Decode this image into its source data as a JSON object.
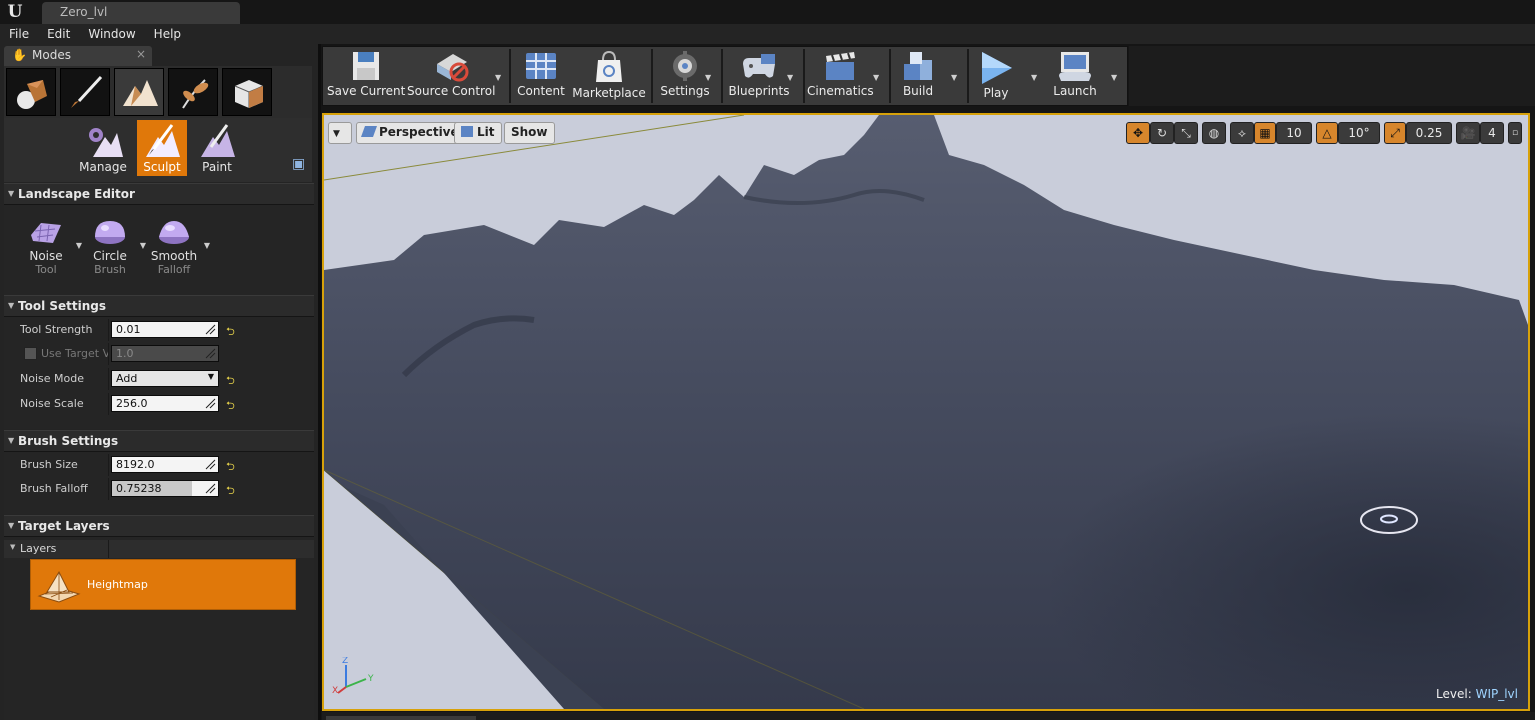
{
  "window": {
    "tab_title": "Zero_lvl"
  },
  "menu": [
    "File",
    "Edit",
    "Window",
    "Help"
  ],
  "modes_panel": {
    "tab_label": "Modes",
    "close": "×",
    "sub_modes": [
      {
        "label": "Manage",
        "active": false
      },
      {
        "label": "Sculpt",
        "active": true
      },
      {
        "label": "Paint",
        "active": false
      }
    ]
  },
  "landscape_editor": {
    "header": "Landscape Editor",
    "tools": [
      {
        "name": "Noise",
        "sub": "Tool"
      },
      {
        "name": "Circle",
        "sub": "Brush"
      },
      {
        "name": "Smooth",
        "sub": "Falloff"
      }
    ]
  },
  "tool_settings": {
    "header": "Tool Settings",
    "tool_strength": {
      "label": "Tool Strength",
      "value": "0.01"
    },
    "use_target": {
      "label": "Use Target Va",
      "value": "1.0"
    },
    "noise_mode": {
      "label": "Noise Mode",
      "value": "Add"
    },
    "noise_scale": {
      "label": "Noise Scale",
      "value": "256.0"
    }
  },
  "brush_settings": {
    "header": "Brush Settings",
    "brush_size": {
      "label": "Brush Size",
      "value": "8192.0"
    },
    "brush_falloff": {
      "label": "Brush Falloff",
      "value": "0.75238",
      "fill_fraction": 0.75238
    }
  },
  "target_layers": {
    "header": "Target Layers",
    "layers_label": "Layers",
    "heightmap_label": "Heightmap"
  },
  "toolbar": {
    "save_current": "Save Current",
    "source_control": "Source Control",
    "content": "Content",
    "marketplace": "Marketplace",
    "settings": "Settings",
    "blueprints": "Blueprints",
    "cinematics": "Cinematics",
    "build": "Build",
    "play": "Play",
    "launch": "Launch"
  },
  "viewport": {
    "perspective": "Perspective",
    "lit": "Lit",
    "show": "Show",
    "grid_snap": "10",
    "rotation_snap": "10°",
    "scale_snap": "0.25",
    "camera_speed": "4",
    "level_prefix": "Level:",
    "level_name": "WIP_lvl"
  },
  "colors": {
    "accent": "#e0780a",
    "viewport_border": "#d7a10a",
    "terrain": "#3d4356"
  }
}
